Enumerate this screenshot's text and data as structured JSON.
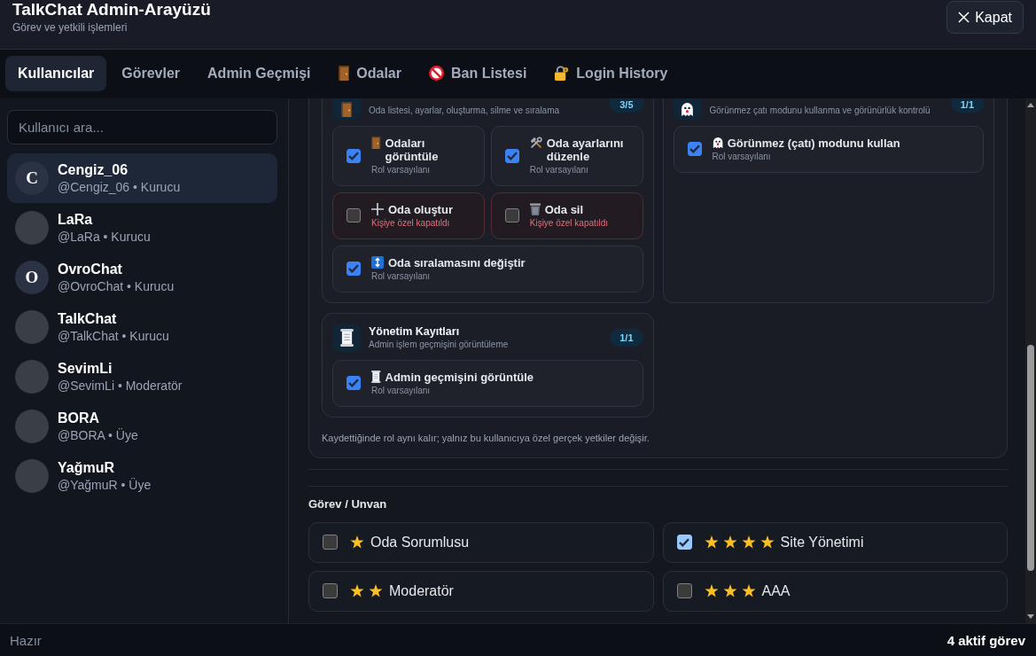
{
  "header": {
    "title": "TalkChat Admin-Arayüzü",
    "subtitle": "Görev ve yetkili işlemleri",
    "close_button": "Kapat"
  },
  "tabs": [
    {
      "label": "Kullanıcılar",
      "kind": "plain",
      "selected": true
    },
    {
      "label": "Görevler",
      "kind": "plain",
      "selected": false
    },
    {
      "label": "Admin Geçmişi",
      "kind": "plain",
      "selected": false
    },
    {
      "label": "Odalar",
      "kind": "door",
      "selected": false
    },
    {
      "label": "Ban Listesi",
      "kind": "prohibited",
      "selected": false
    },
    {
      "label": "Login History",
      "kind": "padlock",
      "selected": false
    }
  ],
  "sidebar": {
    "search": {
      "placeholder": "Kullanıcı ara..."
    },
    "users": [
      {
        "name": "Cengiz_06",
        "handle": "@Cengiz_06 • Kurucu",
        "avatar": {
          "kind": "letter",
          "letter": "C"
        },
        "selected": true
      },
      {
        "name": "LaRa",
        "handle": "@LaRa • Kurucu",
        "avatar": {
          "kind": "photo"
        },
        "selected": false
      },
      {
        "name": "OvroChat",
        "handle": "@OvroChat • Kurucu",
        "avatar": {
          "kind": "letter",
          "letter": "O"
        },
        "selected": false
      },
      {
        "name": "TalkChat",
        "handle": "@TalkChat • Kurucu",
        "avatar": {
          "kind": "photo"
        },
        "selected": false
      },
      {
        "name": "SevimLi",
        "handle": "@SevimLi • Moderatör",
        "avatar": {
          "kind": "photo"
        },
        "selected": false
      },
      {
        "name": "BORA",
        "handle": "@BORA • Üye",
        "avatar": {
          "kind": "photo"
        },
        "selected": false
      },
      {
        "name": "YağmuR",
        "handle": "@YağmuR • Üye",
        "avatar": {
          "kind": "photo"
        },
        "selected": false
      }
    ]
  },
  "permissions": {
    "sections": [
      {
        "kind": "door",
        "description": "Oda listesi, ayarlar, oluşturma, silme ve sıralama",
        "count": "3/5",
        "items": [
          {
            "kind": "door",
            "label": "Odaları görüntüle",
            "note": "Rol varsayılanı",
            "checked": true,
            "overridden": false
          },
          {
            "kind": "tools",
            "label": "Oda ayarlarını düzenle",
            "note": "Rol varsayılanı",
            "checked": true,
            "overridden": false
          },
          {
            "kind": "plus",
            "label": "Oda oluştur",
            "note": "Kişiye özel kapatıldı",
            "checked": false,
            "overridden": true
          },
          {
            "kind": "trash",
            "label": "Oda sil",
            "note": "Kişiye özel kapatıldı",
            "checked": false,
            "overridden": true
          },
          {
            "kind": "updown",
            "label": "Oda sıralamasını değiştir",
            "note": "Rol varsayılanı",
            "checked": true,
            "overridden": false
          }
        ]
      },
      {
        "kind": "ghost",
        "description": "Görünmez çatı modunu kullanma ve görünürlük kontrolü",
        "count": "1/1",
        "items": [
          {
            "kind": "ghost",
            "label": "Görünmez (çatı) modunu kullan",
            "note": "Rol varsayılanı",
            "checked": true,
            "overridden": false
          }
        ]
      },
      {
        "kind": "scroll",
        "title": "Yönetim Kayıtları",
        "description": "Admin işlem geçmişini görüntüleme",
        "count": "1/1",
        "items": [
          {
            "kind": "scroll",
            "label": "Admin geçmişini görüntüle",
            "note": "Rol varsayılanı",
            "checked": true,
            "overridden": false
          }
        ]
      }
    ],
    "footnote": "Kaydettiğinde rol aynı kalır; yalnız bu kullanıcıya özel gerçek yetkiler değişir."
  },
  "roles": {
    "title": "Görev / Unvan",
    "items": [
      {
        "label": "Oda Sorumlusu",
        "stars": 1,
        "checked": false
      },
      {
        "label": "Site Yönetimi",
        "stars": 4,
        "checked": true
      },
      {
        "label": "Moderatör",
        "stars": 2,
        "checked": false
      },
      {
        "label": "AAA",
        "stars": 3,
        "checked": false
      }
    ]
  },
  "status_bar": {
    "left": "Hazır",
    "right": "4 aktif görev"
  }
}
